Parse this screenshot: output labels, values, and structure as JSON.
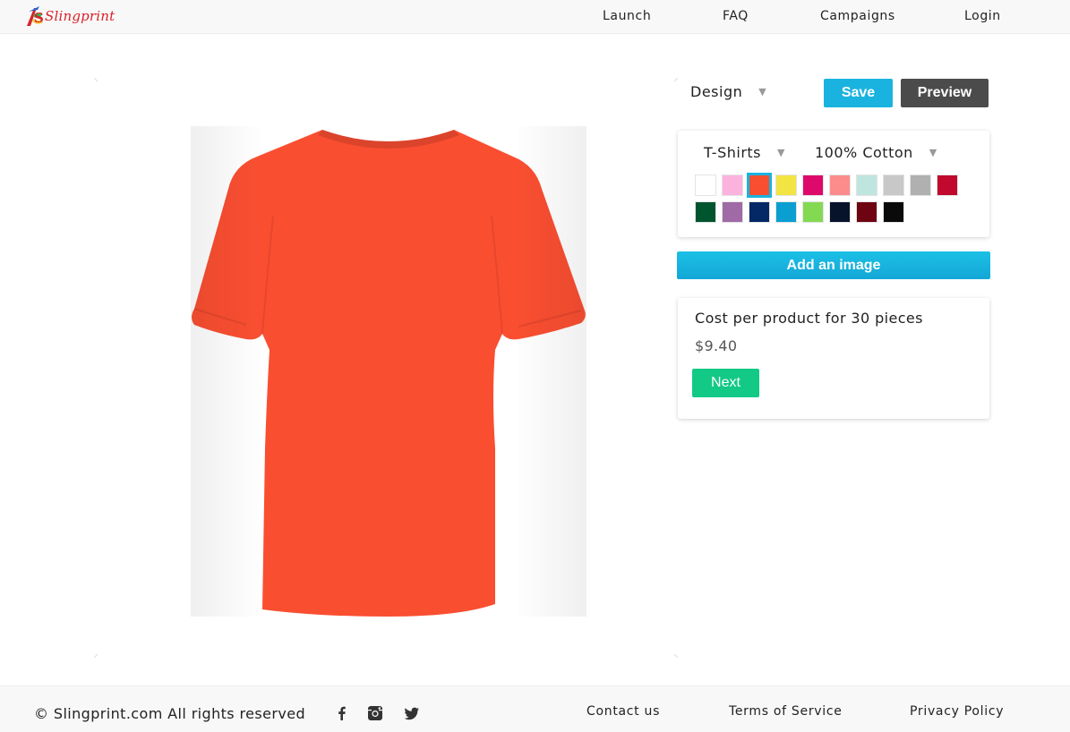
{
  "header": {
    "logo_text": "Slingprint",
    "nav": [
      {
        "label": "Launch"
      },
      {
        "label": "FAQ"
      },
      {
        "label": "Campaigns"
      },
      {
        "label": "Login"
      }
    ]
  },
  "toolbar": {
    "design_select": "Design",
    "save_label": "Save",
    "preview_label": "Preview"
  },
  "product": {
    "type_select": "T-Shirts",
    "material_select": "100% Cotton",
    "shirt_color": "#fa4e31",
    "selected_swatch_index": 2,
    "swatches": [
      "#ffffff",
      "#fbb3dd",
      "#fa4e31",
      "#f2e443",
      "#dd0a6c",
      "#fc8c8c",
      "#bfe5df",
      "#c8c8c8",
      "#b0b0b0",
      "#c0092d",
      "#01552e",
      "#a06aa6",
      "#032865",
      "#0a9ed1",
      "#84d953",
      "#07122b",
      "#6e0312",
      "#0a0a0a"
    ]
  },
  "actions": {
    "add_image_label": "Add an image"
  },
  "cost": {
    "label": "Cost per product for 30 pieces",
    "price": "$9.40",
    "next_label": "Next"
  },
  "footer": {
    "copyright": "© Slingprint.com All rights reserved",
    "social": [
      "facebook-icon",
      "instagram-icon",
      "twitter-icon"
    ],
    "links": [
      {
        "label": "Contact us"
      },
      {
        "label": "Terms of Service"
      },
      {
        "label": "Privacy Policy"
      }
    ]
  },
  "colors": {
    "accent_blue": "#1ab3df",
    "preview_dark": "#4b4b4b",
    "next_green": "#12c986",
    "brand_red": "#d8232a"
  }
}
